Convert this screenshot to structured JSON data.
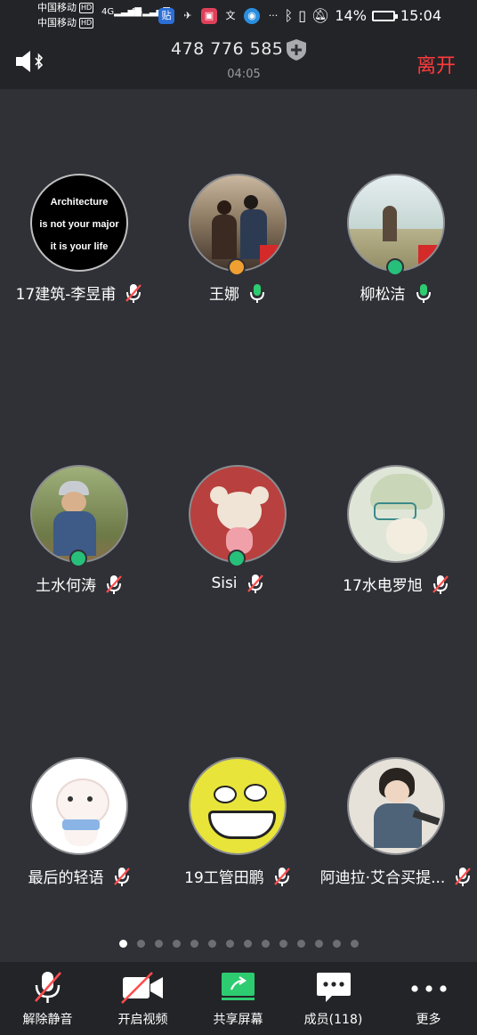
{
  "status_bar": {
    "carrier1": "中国移动",
    "carrier2": "中国移动",
    "hd": "HD",
    "net1": "4G",
    "net2": "4G",
    "battery": "14%",
    "time": "15:04",
    "more": "···"
  },
  "header": {
    "meeting_id": "478 776 585",
    "timer": "04:05",
    "leave": "离开"
  },
  "avatar1_text": [
    "Architecture",
    "is not your major",
    "it is your life"
  ],
  "participants": [
    {
      "name": "17建筑-李昱甫",
      "mic": "muted"
    },
    {
      "name": "王娜",
      "mic": "active"
    },
    {
      "name": "柳松洁",
      "mic": "active"
    },
    {
      "name": "土水何涛",
      "mic": "muted"
    },
    {
      "name": "Sisi",
      "mic": "muted"
    },
    {
      "name": "17水电罗旭",
      "mic": "muted"
    },
    {
      "name": "最后的轻语",
      "mic": "muted"
    },
    {
      "name": "19工管田鹏",
      "mic": "muted"
    },
    {
      "name": "阿迪拉·艾合买提...",
      "mic": "muted"
    }
  ],
  "pager": {
    "pages": 14,
    "current": 1
  },
  "toolbar": {
    "unmute": "解除静音",
    "video": "开启视频",
    "share": "共享屏幕",
    "members": "成员(118)",
    "more": "更多"
  },
  "colors": {
    "background": "#2f3136",
    "bar": "#232428",
    "leave": "#ff3b3b",
    "mic_active": "#2ecc71",
    "mute_slash": "#ff4d4d",
    "host_badge": "#f0a030",
    "cohost_badge": "#27c07a"
  }
}
